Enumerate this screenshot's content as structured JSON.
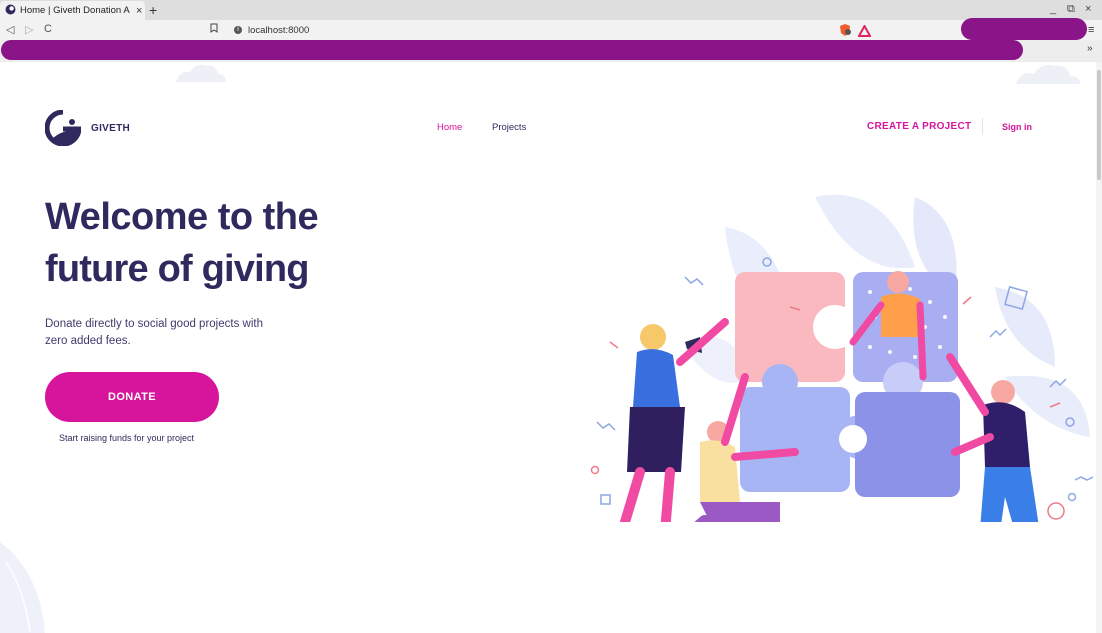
{
  "browser": {
    "tab_title": "Home | Giveth Donation A",
    "tab_close": "×",
    "new_tab": "+",
    "url": "localhost:8000",
    "window_controls": [
      "_",
      "⧉",
      "×"
    ],
    "menu": "≡",
    "bookmarks_more": "»",
    "redaction_color": "#8a1588"
  },
  "header": {
    "brand": "GIVETH",
    "nav": [
      {
        "label": "Home",
        "active": true
      },
      {
        "label": "Projects",
        "active": false
      }
    ],
    "create_project": "CREATE A PROJECT",
    "sign_in": "Sign in"
  },
  "hero": {
    "line1": "Welcome to the",
    "line2": "future of giving",
    "subtitle": "Donate directly to social good projects with zero added fees.",
    "donate_button": "DONATE",
    "raise_funds_link": "Start raising funds for your project"
  },
  "icons": {
    "favicon": "giveth-logo-icon",
    "back": "back-arrow-icon",
    "forward": "forward-arrow-icon",
    "reload": "reload-icon",
    "bookmark": "bookmark-icon",
    "site_info": "site-info-icon",
    "brave_shield": "brave-shield-icon",
    "brave_rewards": "brave-rewards-icon"
  },
  "colors": {
    "accent": "#d6159c",
    "text_dark": "#2f2a5e",
    "background": "#ffffff"
  }
}
